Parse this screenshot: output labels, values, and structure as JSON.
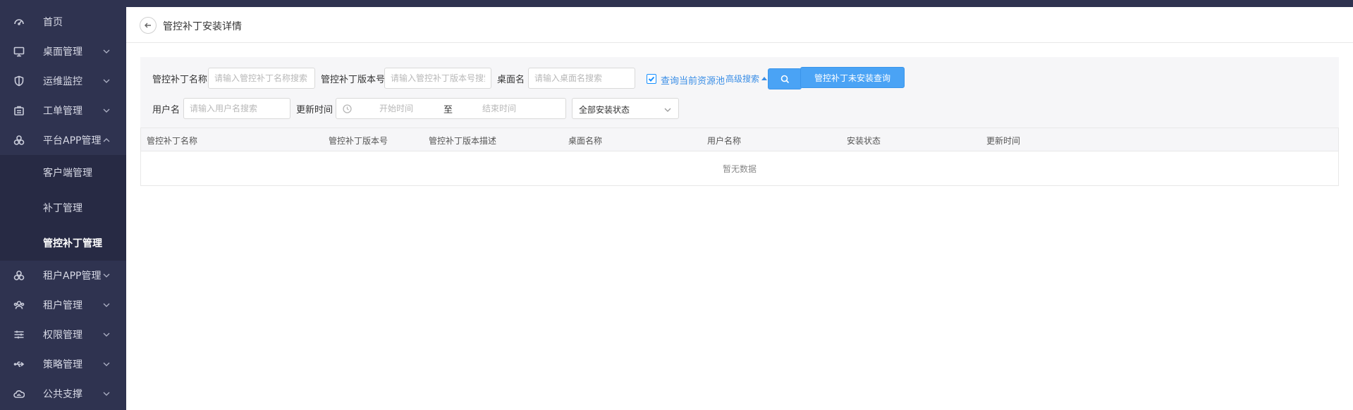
{
  "sidebar": {
    "items": [
      {
        "label": "首页",
        "icon": "dashboard-icon"
      },
      {
        "label": "桌面管理",
        "icon": "monitor-icon"
      },
      {
        "label": "运维监控",
        "icon": "shield-icon"
      },
      {
        "label": "工单管理",
        "icon": "ticket-icon"
      },
      {
        "label": "平台APP管理",
        "icon": "apps-icon"
      },
      {
        "label": "租户APP管理",
        "icon": "apps-icon"
      },
      {
        "label": "租户管理",
        "icon": "users-icon"
      },
      {
        "label": "权限管理",
        "icon": "sliders-icon"
      },
      {
        "label": "策略管理",
        "icon": "usb-icon"
      },
      {
        "label": "公共支撑",
        "icon": "cloud-icon"
      }
    ],
    "submenu": [
      {
        "label": "客户端管理"
      },
      {
        "label": "补丁管理"
      },
      {
        "label": "管控补丁管理"
      }
    ]
  },
  "header": {
    "title": "管控补丁安装详情"
  },
  "filters": {
    "patch_name_label": "管控补丁名称",
    "patch_name_placeholder": "请输入管控补丁名称搜索",
    "patch_version_label": "管控补丁版本号",
    "patch_version_placeholder": "请输入管控补丁版本号搜索",
    "desktop_label": "桌面名",
    "desktop_placeholder": "请输入桌面名搜索",
    "current_pool_label": "查询当前资源池",
    "current_pool_checked": true,
    "advanced_label": "高级搜索",
    "not_installed_button": "管控补丁未安装查询",
    "username_label": "用户名",
    "username_placeholder": "请输入用户名搜索",
    "update_time_label": "更新时间",
    "start_placeholder": "开始时间",
    "range_separator": "至",
    "end_placeholder": "结束时间",
    "status_select_value": "全部安装状态"
  },
  "table": {
    "columns": [
      "管控补丁名称",
      "管控补丁版本号",
      "管控补丁版本描述",
      "桌面名称",
      "用户名称",
      "安装状态",
      "更新时间"
    ],
    "empty_text": "暂无数据"
  },
  "colors": {
    "sidebar_bg": "#2f3350",
    "primary": "#4aa3f5",
    "link": "#3a8ee6"
  }
}
